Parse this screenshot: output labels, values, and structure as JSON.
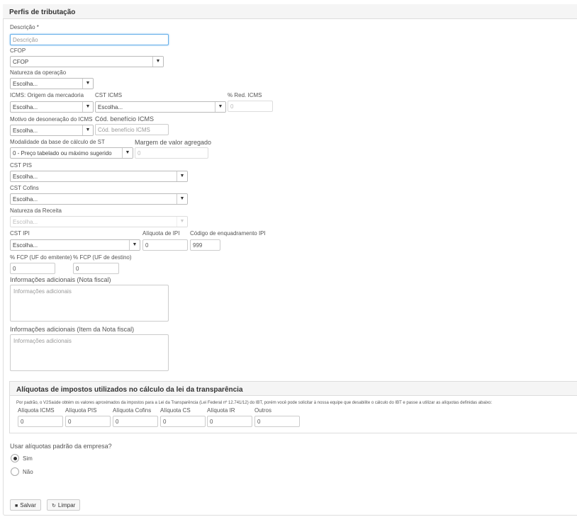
{
  "panel": {
    "title": "Perfis de tributação"
  },
  "form": {
    "descricao": {
      "label": "Descrição *",
      "placeholder": "Descrição"
    },
    "cfop": {
      "label": "CFOP",
      "value": "CFOP"
    },
    "natureza_operacao": {
      "label": "Natureza da operação",
      "value": "Escolha..."
    },
    "icms_origem": {
      "label": "ICMS: Origem da mercadoria",
      "value": "Escolha..."
    },
    "cst_icms": {
      "label": "CST ICMS",
      "value": "Escolha..."
    },
    "red_icms": {
      "label": "% Red. ICMS",
      "value": "0"
    },
    "motivo_desoneracao": {
      "label": "Motivo de desoneração do ICMS",
      "value": "Escolha..."
    },
    "cod_beneficio": {
      "label": "Cód. benefício ICMS",
      "placeholder": "Cód. benefício ICMS"
    },
    "modalidade_st": {
      "label": "Modalidade da base de cálculo de ST",
      "value": "0 - Preço tabelado ou máximo sugerido"
    },
    "margem_valor": {
      "label": "Margem de valor agregado",
      "value": "0"
    },
    "cst_pis": {
      "label": "CST PIS",
      "value": "Escolha..."
    },
    "cst_cofins": {
      "label": "CST Cofins",
      "value": "Escolha..."
    },
    "natureza_receita": {
      "label": "Natureza da Receita",
      "value": "Escolha..."
    },
    "cst_ipi": {
      "label": "CST IPI",
      "value": "Escolha..."
    },
    "aliquota_ipi": {
      "label": "Alíquota de IPI",
      "value": "0"
    },
    "cod_enquadramento_ipi": {
      "label": "Código de enquadramento IPI",
      "value": "999"
    },
    "fcp_emitente": {
      "label": "% FCP (UF do emitente)",
      "value": "0"
    },
    "fcp_destino": {
      "label": "% FCP (UF de destino)",
      "value": "0"
    },
    "info_nota": {
      "label": "Informações adicionais (Nota fiscal)",
      "placeholder": "Informações adicionais"
    },
    "info_item": {
      "label": "Informações adicionais (Item da Nota fiscal)",
      "placeholder": "Informações adicionais"
    }
  },
  "transparencia": {
    "title": "Alíquotas de impostos utilizados no cálculo da lei da transparência",
    "note": "Por padrão, o V2Saúde obtém os valores aproximados da impostos para a Lei da Transparência (Lei Federal nº 12.741/12) do IBT, porém você pode solicitar à nossa equipe que desabilite o cálculo do IBT e passe a utilizar as alíquotas definidas abaixo:",
    "fields": [
      {
        "label": "Alíquota ICMS",
        "value": "0"
      },
      {
        "label": "Alíquota PIS",
        "value": "0"
      },
      {
        "label": "Alíquota Cofins",
        "value": "0"
      },
      {
        "label": "Alíquota CS",
        "value": "0"
      },
      {
        "label": "Alíquota IR",
        "value": "0"
      },
      {
        "label": "Outros",
        "value": "0"
      }
    ]
  },
  "aliquotas_padrao": {
    "question": "Usar alíquotas padrão da empresa?",
    "options": [
      "Sim",
      "Não"
    ],
    "selected": "Sim"
  },
  "actions": {
    "save": "Salvar",
    "clear": "Limpar"
  },
  "icons": {
    "save": "floppy-icon",
    "clear": "refresh-icon",
    "dropdown": "caret-down-icon"
  }
}
